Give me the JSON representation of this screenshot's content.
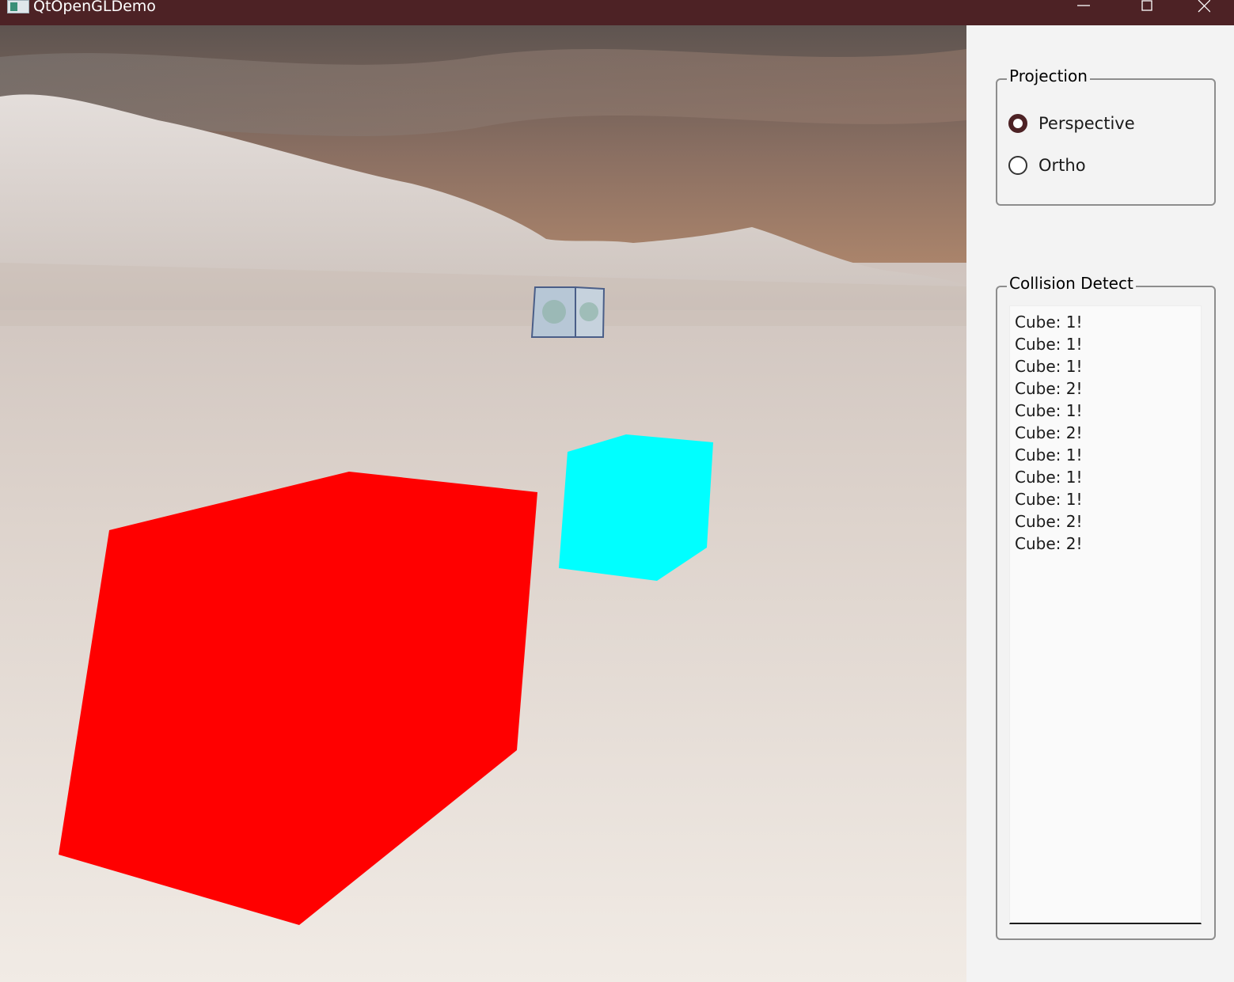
{
  "window": {
    "title": "QtOpenGLDemo"
  },
  "scene": {
    "cube_colors": {
      "red": "#ff0000",
      "cyan": "#00ffff",
      "sky": "#6b5a55",
      "snow": "#e9e1d9"
    }
  },
  "projection": {
    "title": "Projection",
    "options": [
      {
        "label": "Perspective",
        "checked": true
      },
      {
        "label": "Ortho",
        "checked": false
      }
    ]
  },
  "collision": {
    "title": "Collision Detect",
    "log": [
      "Cube: 1!",
      "Cube: 1!",
      "Cube: 1!",
      "Cube: 2!",
      "Cube: 1!",
      "Cube: 2!",
      "Cube: 1!",
      "Cube: 1!",
      "Cube: 1!",
      "Cube: 2!",
      "Cube: 2!"
    ]
  }
}
